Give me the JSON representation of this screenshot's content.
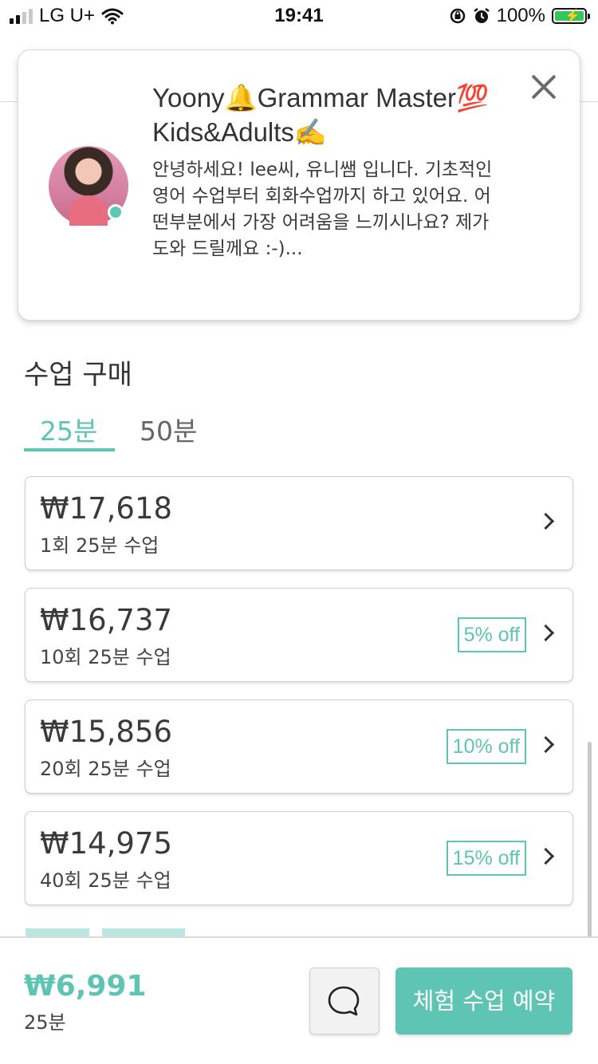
{
  "status_bar": {
    "carrier": "LG U+",
    "time": "19:41",
    "battery": "100%"
  },
  "tutor": {
    "name": "Yoony🔔Grammar Master💯 Kids&Adults✍️",
    "intro": "안녕하세요! lee씨, 유니쌤 입니다. 기초적인 영어 수업부터 회화수업까지 하고 있어요. 어떤부분에서 가장 어려움을 느끼시나요? 제가 도와 드릴께요 :-)...",
    "online_color": "#5cc9b5"
  },
  "purchase": {
    "title": "수업 구매",
    "tabs": [
      {
        "label": "25분",
        "selected": true
      },
      {
        "label": "50분",
        "selected": false
      }
    ],
    "packages": [
      {
        "price": "₩17,618",
        "desc": "1회 25분 수업",
        "discount": ""
      },
      {
        "price": "₩16,737",
        "desc": "10회 25분 수업",
        "discount": "5% off"
      },
      {
        "price": "₩15,856",
        "desc": "20회 25분 수업",
        "discount": "10% off"
      },
      {
        "price": "₩14,975",
        "desc": "40회 25분 수업",
        "discount": "15% off"
      }
    ]
  },
  "bottom": {
    "trial_price": "₩6,991",
    "trial_duration": "25분",
    "book_label": "체험 수업 예약"
  },
  "colors": {
    "accent": "#5ec4b4"
  },
  "icons": [
    "close-icon",
    "chat-bubble-icon",
    "chevron-right-icon",
    "wifi-icon",
    "alarm-icon",
    "battery-icon"
  ]
}
